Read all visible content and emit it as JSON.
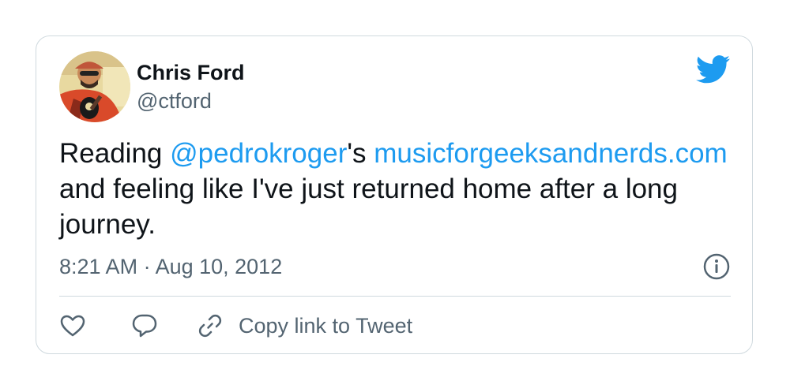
{
  "tweet": {
    "author_name": "Chris Ford",
    "author_handle": "@ctford",
    "text_prefix": "Reading ",
    "mention": "@pedrokroger",
    "text_possessive": "'s ",
    "link": "musicforgeeksandnerds.com",
    "text_suffix": " and feeling like I've just returned home after a long journey.",
    "timestamp": "8:21 AM · Aug 10, 2012"
  },
  "actions": {
    "copy_link_label": "Copy link to Tweet"
  },
  "icons": {
    "brand": "twitter-bird-icon",
    "info": "info-icon",
    "like": "heart-icon",
    "reply": "reply-icon",
    "copy": "link-icon"
  },
  "colors": {
    "brand_blue": "#1d9bf0",
    "text_primary": "#0f1419",
    "text_secondary": "#536471",
    "border": "#cfd9de"
  }
}
